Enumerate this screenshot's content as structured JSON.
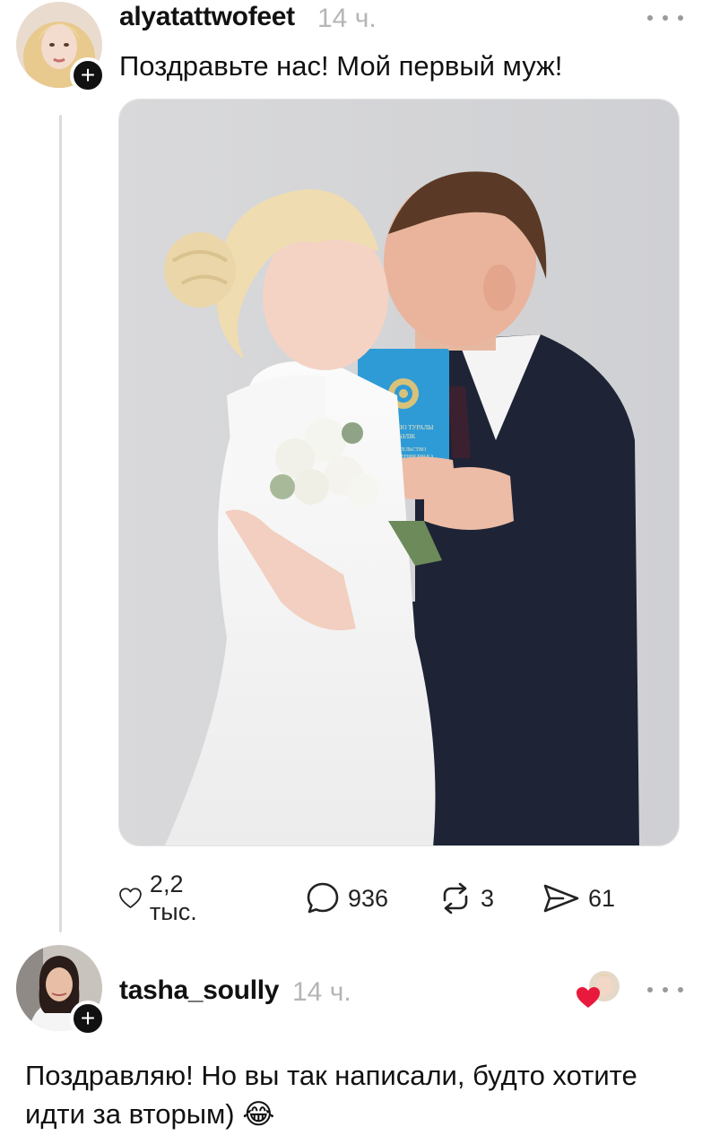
{
  "post": {
    "username": "alyatattwofeet",
    "time": "14 ч.",
    "text": "Поздравьте нас! Мой первый муж!",
    "follow_symbol": "+",
    "certificate_text": {
      "line1": "НЕКЕ ҚИЮ ТУРАЛЫ",
      "line2": "КУӘЛІК",
      "line3": "СВИДЕТЕЛЬСТВО",
      "line4": "О ЗАКЛЮЧЕНИИ БРАКА"
    },
    "actions": {
      "likes": "2,2 тыс.",
      "comments": "936",
      "reposts": "3",
      "shares": "61"
    },
    "icons": {
      "like": "heart-icon",
      "comment": "comment-icon",
      "repost": "repost-icon",
      "share": "send-icon",
      "more": "more-icon"
    }
  },
  "reply": {
    "username": "tasha_soully",
    "time": "14 ч.",
    "follow_symbol": "+",
    "text": "Поздравляю! Но вы так написали, будто хотите идти за вторым) 😂",
    "liked_by_author_icon": "liked-by-author-icon"
  },
  "colors": {
    "text": "#111111",
    "muted": "#b5b5b5",
    "heart_red": "#e8193c",
    "certificate_blue": "#2f9bd6",
    "background": "#ffffff"
  }
}
